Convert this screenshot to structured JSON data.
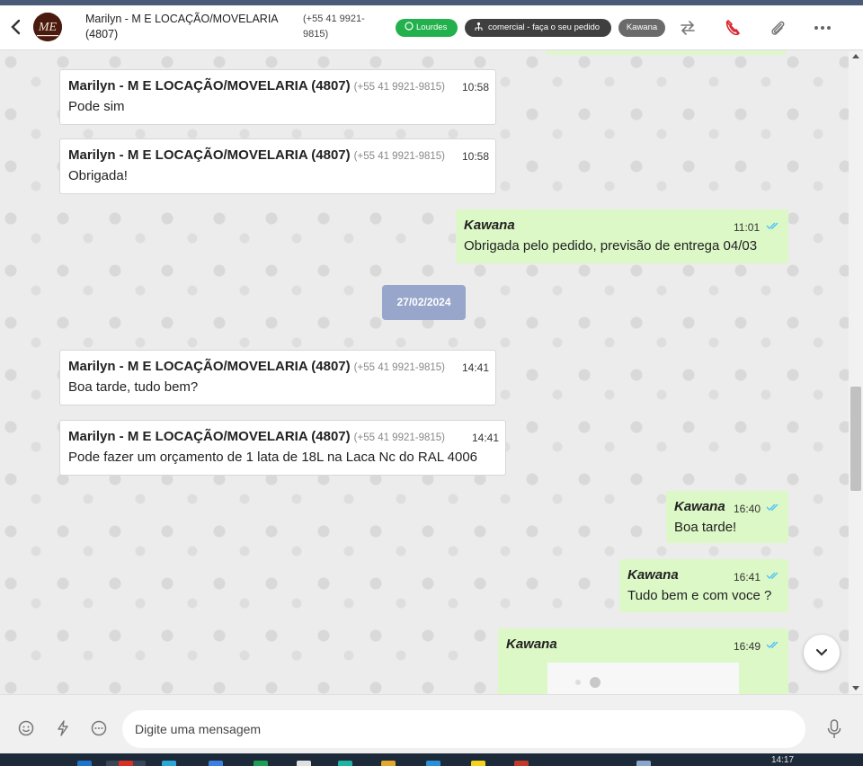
{
  "header": {
    "contact_name": "Marilyn - M E LOCAÇÃO/MOVELARIA (4807)",
    "contact_phone": "(+55 41 9921-9815)",
    "tags": [
      {
        "label": "Lourdes",
        "color": "#22b14c"
      },
      {
        "label": "comercial - faça o seu pedido",
        "color": "#3f3f3f"
      },
      {
        "label": "Kawana",
        "color": "#6a6a6a"
      }
    ],
    "avatar_monogram": "ME"
  },
  "messages": [
    {
      "dir": "in",
      "sender": "Marilyn - M E LOCAÇÃO/MOVELARIA (4807)",
      "phone": "(+55 41 9921-9815)",
      "time": "10:58",
      "text": "Pode sim"
    },
    {
      "dir": "in",
      "sender": "Marilyn - M E LOCAÇÃO/MOVELARIA (4807)",
      "phone": "(+55 41 9921-9815)",
      "time": "10:58",
      "text": "Obrigada!"
    },
    {
      "dir": "out",
      "sender": "Kawana",
      "time": "11:01",
      "text": "Obrigada pelo pedido, previsão de entrega 04/03"
    },
    {
      "dir": "in",
      "sender": "Marilyn - M E LOCAÇÃO/MOVELARIA (4807)",
      "phone": "(+55 41 9921-9815)",
      "time": "14:41",
      "text": "Boa tarde, tudo bem?"
    },
    {
      "dir": "in",
      "sender": "Marilyn - M E LOCAÇÃO/MOVELARIA (4807)",
      "phone": "(+55 41 9921-9815)",
      "time": "14:41",
      "text": "Pode fazer um orçamento de 1 lata de 18L na Laca Nc do RAL 4006"
    },
    {
      "dir": "out",
      "sender": "Kawana",
      "time": "16:40",
      "text": "Boa tarde!"
    },
    {
      "dir": "out",
      "sender": "Kawana",
      "time": "16:41",
      "text": "Tudo bem e com voce ?"
    },
    {
      "dir": "out",
      "sender": "Kawana",
      "time": "16:49",
      "text": ""
    }
  ],
  "date_separator": "27/02/2024",
  "composer": {
    "placeholder": "Digite uma mensagem"
  },
  "taskbar": {
    "clock": "14:17"
  },
  "colors": {
    "incoming_bg": "#ffffff",
    "outgoing_bg": "#dcf8c6",
    "read_ticks": "#4fc3f7",
    "call_icon": "#d9262c"
  }
}
